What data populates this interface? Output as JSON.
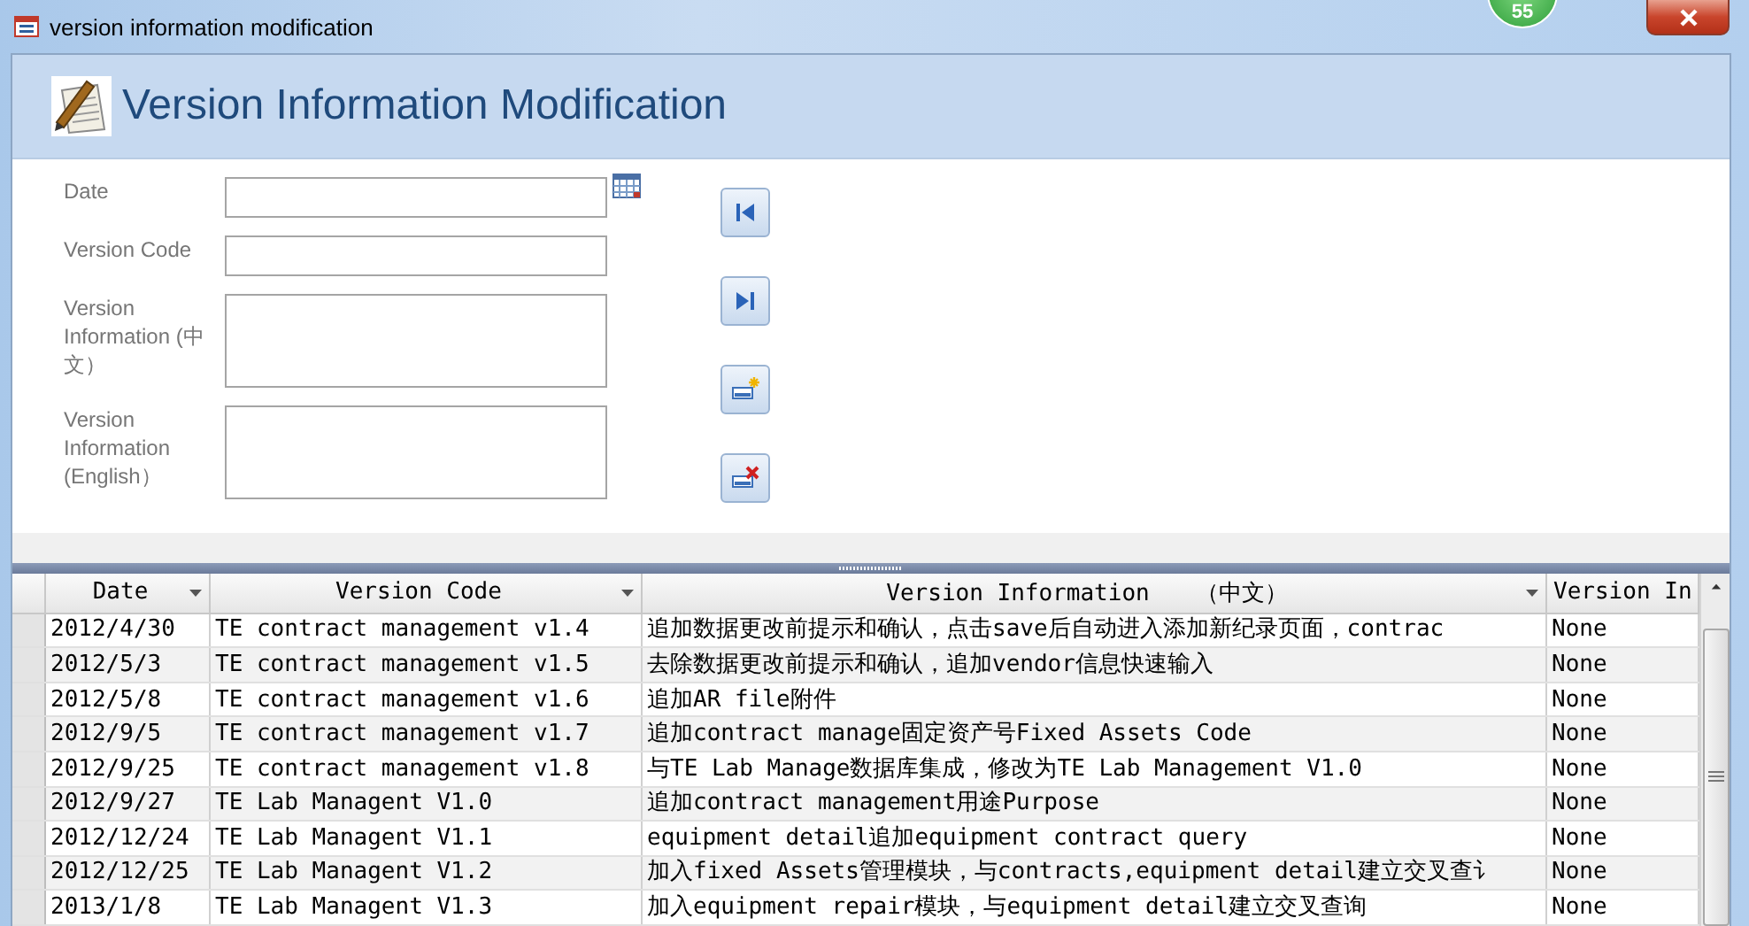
{
  "window": {
    "title": "version information modification",
    "badge": "55"
  },
  "header": {
    "title": "Version Information Modification"
  },
  "form": {
    "fields": [
      {
        "label": "Date",
        "kind": "date"
      },
      {
        "label": "Version Code",
        "kind": "line"
      },
      {
        "label": "Version Information (中文）",
        "kind": "area"
      },
      {
        "label": "Version Information (English）",
        "kind": "area"
      }
    ],
    "buttons": [
      {
        "kind": "first"
      },
      {
        "kind": "last"
      },
      {
        "kind": "new"
      },
      {
        "kind": "delete"
      }
    ]
  },
  "table": {
    "columns": [
      "Date",
      "Version Code",
      "Version Information　　（中文）",
      "Version In"
    ],
    "rows": [
      [
        "2012/4/30",
        "TE contract management v1.4",
        "追加数据更改前提示和确认，点击save后自动进入添加新纪录页面，contrac",
        "None"
      ],
      [
        "2012/5/3",
        "TE contract management v1.5",
        "去除数据更改前提示和确认，追加vendor信息快速输入",
        "None"
      ],
      [
        "2012/5/8",
        "TE contract management v1.6",
        "追加AR file附件",
        "None"
      ],
      [
        "2012/9/5",
        "TE contract management v1.7",
        "追加contract manage固定资产号Fixed Assets Code",
        "None"
      ],
      [
        "2012/9/25",
        "TE contract management v1.8",
        "与TE Lab Manage数据库集成，修改为TE Lab Management V1.0",
        "None"
      ],
      [
        "2012/9/27",
        "TE Lab Managent V1.0",
        "追加contract management用途Purpose",
        "None"
      ],
      [
        "2012/12/24",
        "TE Lab Managent V1.1",
        "equipment detail追加equipment contract query",
        "None"
      ],
      [
        "2012/12/25",
        "TE Lab Managent V1.2",
        "加入fixed Assets管理模块，与contracts,equipment detail建立交叉查讠",
        "None"
      ],
      [
        "2013/1/8",
        "TE Lab Managent V1.3",
        "加入equipment repair模块，与equipment detail建立交叉查询",
        "None"
      ]
    ]
  }
}
